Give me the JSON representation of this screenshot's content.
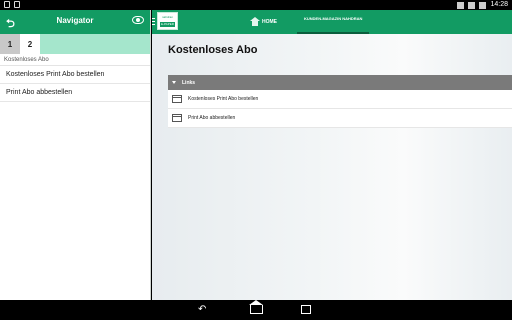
{
  "status_bar": {
    "time": "14:28"
  },
  "navigator": {
    "title": "Navigator",
    "tabs": [
      {
        "label": "1"
      },
      {
        "label": "2"
      }
    ],
    "breadcrumb": "Kostenloses Abo",
    "items": [
      {
        "label": "Kostenloses Print Abo bestellen"
      },
      {
        "label": "Print Abo abbestellen"
      }
    ]
  },
  "topnav": {
    "logo_top": "nahdran",
    "logo_badge": "E-PAPER",
    "home_label": "HOME",
    "magazine_label": "KUNDEN-MAGAZIN NAHDRAN"
  },
  "main": {
    "page_title": "Kostenloses Abo",
    "links_header": "Links",
    "links": [
      {
        "label": "Kostenloses Print Abo bestellen"
      },
      {
        "label": "Print Abo abbestellen"
      }
    ]
  },
  "colors": {
    "accent": "#129b63",
    "tabs_bg": "#a5e6cc",
    "links_header_bg": "#7a7a7a"
  }
}
